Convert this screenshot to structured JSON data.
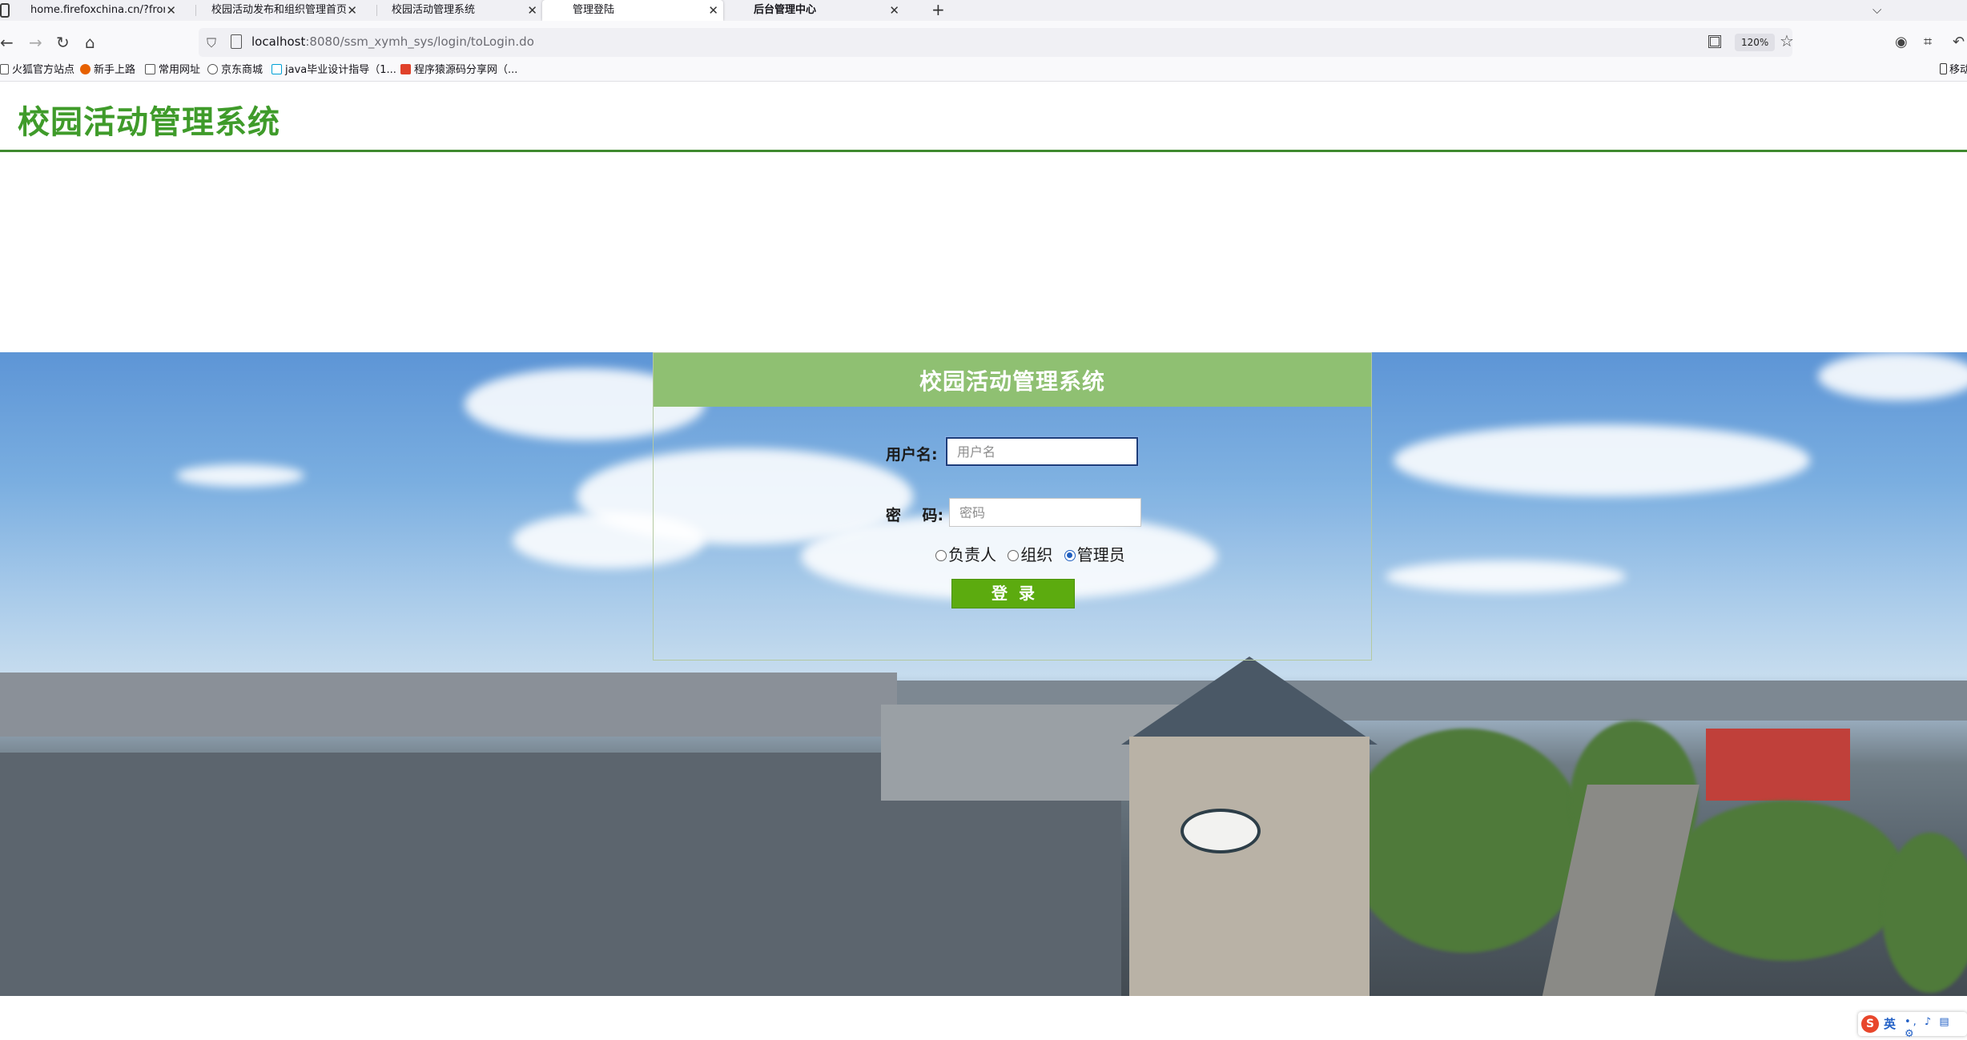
{
  "browser": {
    "tabs": [
      {
        "title": "home.firefoxchina.cn/?from=extra_start",
        "active": false
      },
      {
        "title": "校园活动发布和组织管理首页",
        "active": false
      },
      {
        "title": "校园活动管理系统",
        "active": false
      },
      {
        "title": "管理登陆",
        "active": true
      },
      {
        "title": "后台管理中心",
        "active": false
      }
    ],
    "new_tab_symbol": "+",
    "close_symbol": "✕",
    "url_host": "localhost",
    "url_rest": ":8080/ssm_xymh_sys/login/toLogin.do",
    "zoom": "120%",
    "bookmarks": [
      {
        "label": "火狐官方站点",
        "icon": "firefox-icon",
        "color": "#e66000"
      },
      {
        "label": "新手上路",
        "icon": "firefox-icon",
        "color": "#e66000"
      },
      {
        "label": "常用网址",
        "icon": "folder-icon",
        "color": "#555555"
      },
      {
        "label": "京东商城",
        "icon": "globe-icon",
        "color": "#555555"
      },
      {
        "label": "java毕业设计指导（1...",
        "icon": "bilibili-icon",
        "color": "#00a1d6"
      },
      {
        "label": "程序猿源码分享网（...",
        "icon": "c-logo-icon",
        "color": "#e0412a"
      }
    ],
    "mobile_bookmarks": "移动"
  },
  "site": {
    "title": "校园活动管理系统"
  },
  "login": {
    "panel_title": "校园活动管理系统",
    "username_label": "用户名:",
    "username_placeholder": "用户名",
    "username_value": "",
    "password_label": "密    码:",
    "password_placeholder": "密码",
    "roles": [
      {
        "label": "负责人",
        "checked": false
      },
      {
        "label": "组织",
        "checked": false
      },
      {
        "label": "管理员",
        "checked": true
      }
    ],
    "submit_label": "登录"
  },
  "ime": {
    "logo": "S",
    "lang": "英",
    "tools": "•, ♪ ▤ ⚙"
  },
  "colors": {
    "site_title": "#3f9b2a",
    "header_rule": "#3f8a2f",
    "panel_header": "#8fc072",
    "login_button": "#5cab0f"
  }
}
